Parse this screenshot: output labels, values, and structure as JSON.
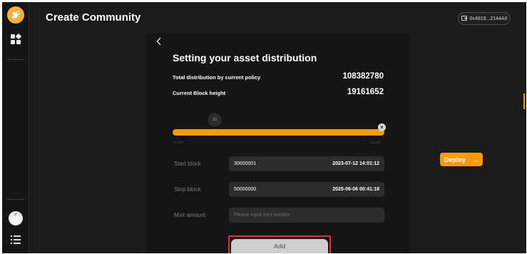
{
  "header": {
    "title": "Create Community",
    "wallet_address": "0x4819...2144A0"
  },
  "form": {
    "title": "Setting your asset distribution",
    "stats": [
      {
        "label": "Total distribution by current policy",
        "value": "108382780"
      },
      {
        "label": "Current Block height",
        "value": "19161652"
      }
    ],
    "slider": {
      "thumb_label": "10",
      "min_label": "19.16M",
      "max_label": "50.00M"
    },
    "start_block": {
      "label": "Start block",
      "value": "30000001",
      "date": "2023-07-12 14:01:12"
    },
    "stop_block": {
      "label": "Stop block",
      "value": "50000000",
      "date": "2025-06-06 00:41:18"
    },
    "mint_amount": {
      "label": "Mint amount",
      "placeholder": "Please input mint number",
      "value": ""
    },
    "add_label": "Add"
  },
  "deploy": {
    "label": "Deploy",
    "arrow": "→"
  },
  "colors": {
    "accent": "#f59b0c",
    "background": "#1b1b1b",
    "panel": "#151515",
    "highlight_border": "#e23232"
  },
  "icons": {
    "logo": "squirrel-logo-icon",
    "apps": "grid-apps-icon",
    "avatar": "user-avatar-icon",
    "menu": "menu-list-icon",
    "wallet": "wallet-icon",
    "back": "chevron-left-icon",
    "close": "close-icon",
    "arrow": "arrow-right-icon"
  }
}
